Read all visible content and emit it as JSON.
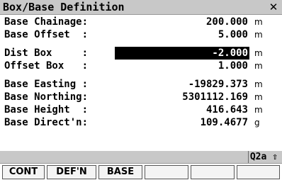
{
  "window": {
    "title": "Box/Base Definition",
    "close_glyph": "✕"
  },
  "fields": [
    {
      "label": "Base Chainage:",
      "value": "200.000",
      "unit": "m"
    },
    {
      "label": "Base Offset  :",
      "value": "5.000",
      "unit": "m"
    },
    {
      "label": "Dist Box     :",
      "value": "-2.000",
      "unit": "m"
    },
    {
      "label": "Offset Box   :",
      "value": "1.000",
      "unit": "m"
    },
    {
      "label": "Base Easting :",
      "value": "-19829.373",
      "unit": "m"
    },
    {
      "label": "Base Northing:",
      "value": "5301112.169",
      "unit": "m"
    },
    {
      "label": "Base Height  :",
      "value": "416.643",
      "unit": "m"
    },
    {
      "label": "Base Direct'n:",
      "value": "109.4677",
      "unit": "g"
    }
  ],
  "status": {
    "indicator": "Q2a ⇧"
  },
  "softkeys": [
    "CONT",
    "DEF'N",
    "BASE",
    "",
    "",
    ""
  ]
}
